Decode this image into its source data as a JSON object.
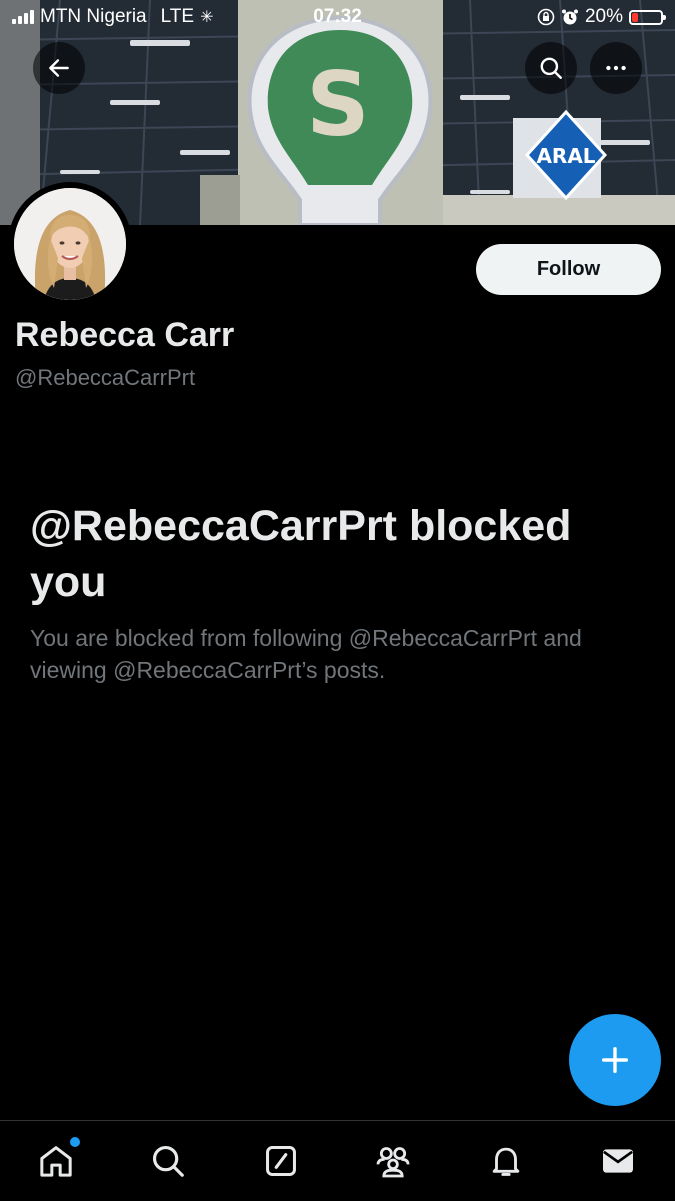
{
  "status_bar": {
    "carrier": "MTN Nigeria",
    "network": "LTE",
    "time": "07:32",
    "battery_text": "20%",
    "battery_level": 0.2,
    "battery_color": "#ff3b30"
  },
  "banner": {
    "sign_letter": "S",
    "aral_text": "ARAL"
  },
  "header": {
    "back_icon": "arrow-left-icon",
    "search_icon": "search-icon",
    "more_icon": "more-horizontal-icon"
  },
  "profile": {
    "display_name": "Rebecca Carr",
    "handle": "@RebeccaCarrPrt",
    "follow_label": "Follow"
  },
  "blocked": {
    "title": "@RebeccaCarrPrt blocked you",
    "description": "You are blocked from following @RebeccaCarrPrt and viewing @RebeccaCarrPrt’s posts."
  },
  "fab": {
    "icon": "plus-icon",
    "color": "#1d9bf0"
  },
  "bottom_nav": {
    "items": [
      {
        "icon": "home-icon",
        "has_notification_dot": true
      },
      {
        "icon": "search-icon"
      },
      {
        "icon": "compose-icon"
      },
      {
        "icon": "communities-icon"
      },
      {
        "icon": "bell-icon"
      },
      {
        "icon": "mail-icon"
      }
    ]
  }
}
